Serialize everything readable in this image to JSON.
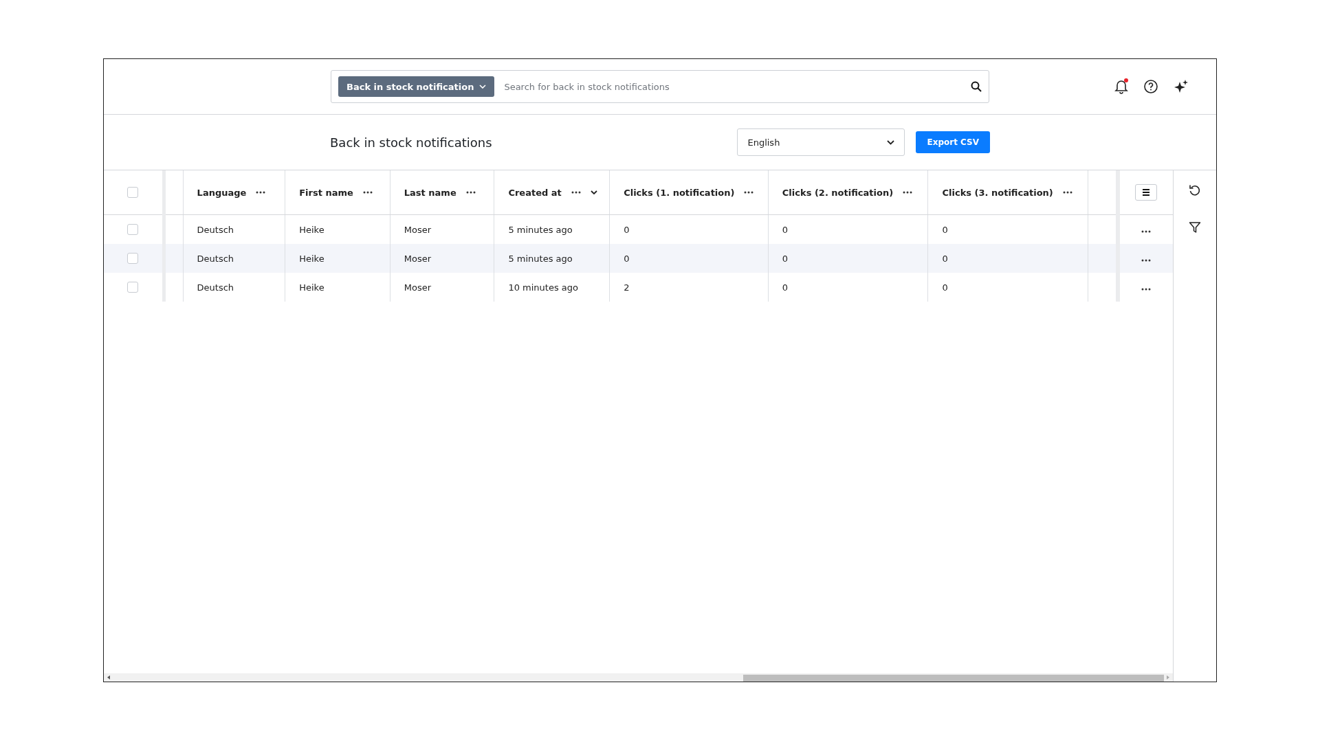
{
  "search": {
    "scope": "Back in stock notification",
    "placeholder": "Search for back in stock notifications"
  },
  "notifications": {
    "unread": true
  },
  "page": {
    "title": "Back in stock notifications",
    "language": "English",
    "export_button": "Export CSV"
  },
  "table": {
    "select_all": {
      "checked": false
    },
    "columns": [
      {
        "label": "Language",
        "sortable": false
      },
      {
        "label": "First name",
        "sortable": false
      },
      {
        "label": "Last name",
        "sortable": false
      },
      {
        "label": "Created at",
        "sortable": true
      },
      {
        "label": "Clicks (1. notification)",
        "sortable": false
      },
      {
        "label": "Clicks (2. notification)",
        "sortable": false
      },
      {
        "label": "Clicks (3. notification)",
        "sortable": false
      }
    ],
    "rows": [
      {
        "checked": false,
        "hovered": false,
        "cells": [
          "Deutsch",
          "Heike",
          "Moser",
          "5 minutes ago",
          "0",
          "0",
          "0"
        ]
      },
      {
        "checked": false,
        "hovered": true,
        "cells": [
          "Deutsch",
          "Heike",
          "Moser",
          "5 minutes ago",
          "0",
          "0",
          "0"
        ]
      },
      {
        "checked": false,
        "hovered": false,
        "cells": [
          "Deutsch",
          "Heike",
          "Moser",
          "10 minutes ago",
          "2",
          "0",
          "0"
        ]
      }
    ]
  }
}
